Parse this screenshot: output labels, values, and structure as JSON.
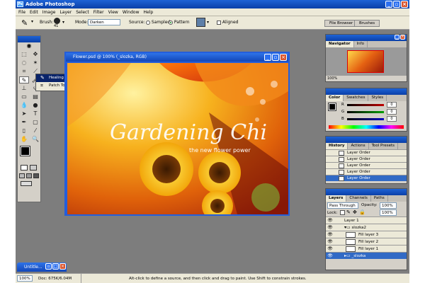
{
  "app": {
    "title": "Adobe Photoshop",
    "logo": "Ps"
  },
  "menu": [
    "File",
    "Edit",
    "Image",
    "Layer",
    "Select",
    "Filter",
    "View",
    "Window",
    "Help"
  ],
  "options": {
    "brush_label": "Brush:",
    "brush_size": "41",
    "mode_label": "Mode:",
    "mode_value": "Darken",
    "source_label": "Source:",
    "sampled_label": "Sampled",
    "pattern_label": "Pattern",
    "source_selected": "Pattern",
    "aligned_label": "Aligned",
    "file_browser_label": "File Browser",
    "brushes_label": "Brushes"
  },
  "tool_flyout": {
    "items": [
      "Healing Brush Tool",
      "Patch Tool"
    ],
    "shortcut": "J",
    "active": 0
  },
  "document": {
    "title": "Flower.psd @ 100% (_slozka, RGB)",
    "headline": "Gardening Chi",
    "tagline": "the new flower power"
  },
  "navigator": {
    "tabs": [
      "Navigator",
      "Info"
    ],
    "zoom": "100%"
  },
  "color_panel": {
    "tabs": [
      "Color",
      "Swatches",
      "Styles"
    ],
    "channels": [
      {
        "label": "R",
        "value": "0",
        "color": "#c00000"
      },
      {
        "label": "G",
        "value": "0",
        "color": "#00a000"
      },
      {
        "label": "B",
        "value": "0",
        "color": "#0000c0"
      }
    ]
  },
  "history": {
    "tabs": [
      "History",
      "Actions",
      "Tool Presets"
    ],
    "items": [
      "Layer Order",
      "Layer Order",
      "Layer Order",
      "Layer Order",
      "Layer Order"
    ],
    "selected": 4
  },
  "layers": {
    "tabs": [
      "Layers",
      "Channels",
      "Paths"
    ],
    "blend_mode": "Pass Through",
    "opacity_label": "Opacity:",
    "opacity_value": "100%",
    "lock_label": "Lock:",
    "fill_value": "100%",
    "rows": [
      {
        "name": "Layer 1",
        "selected": false
      },
      {
        "name": "slozka2",
        "selected": false
      },
      {
        "name": "Fill layer 3",
        "selected": false
      },
      {
        "name": "Fill layer 2",
        "selected": false
      },
      {
        "name": "Fill layer 1",
        "selected": false
      },
      {
        "name": "_slozka",
        "selected": true
      }
    ]
  },
  "minimized_doc": {
    "title": "Untitle..."
  },
  "status": {
    "zoom": "100%",
    "doc_size": "Doc: 675K/6.04M",
    "hint": "Alt-click to define a source, and then click and drag to paint. Use Shift to constrain strokes."
  },
  "colors": {
    "xp_blue": "#0a3fa8",
    "selection": "#316ac5",
    "workspace": "#7d7d7d"
  }
}
